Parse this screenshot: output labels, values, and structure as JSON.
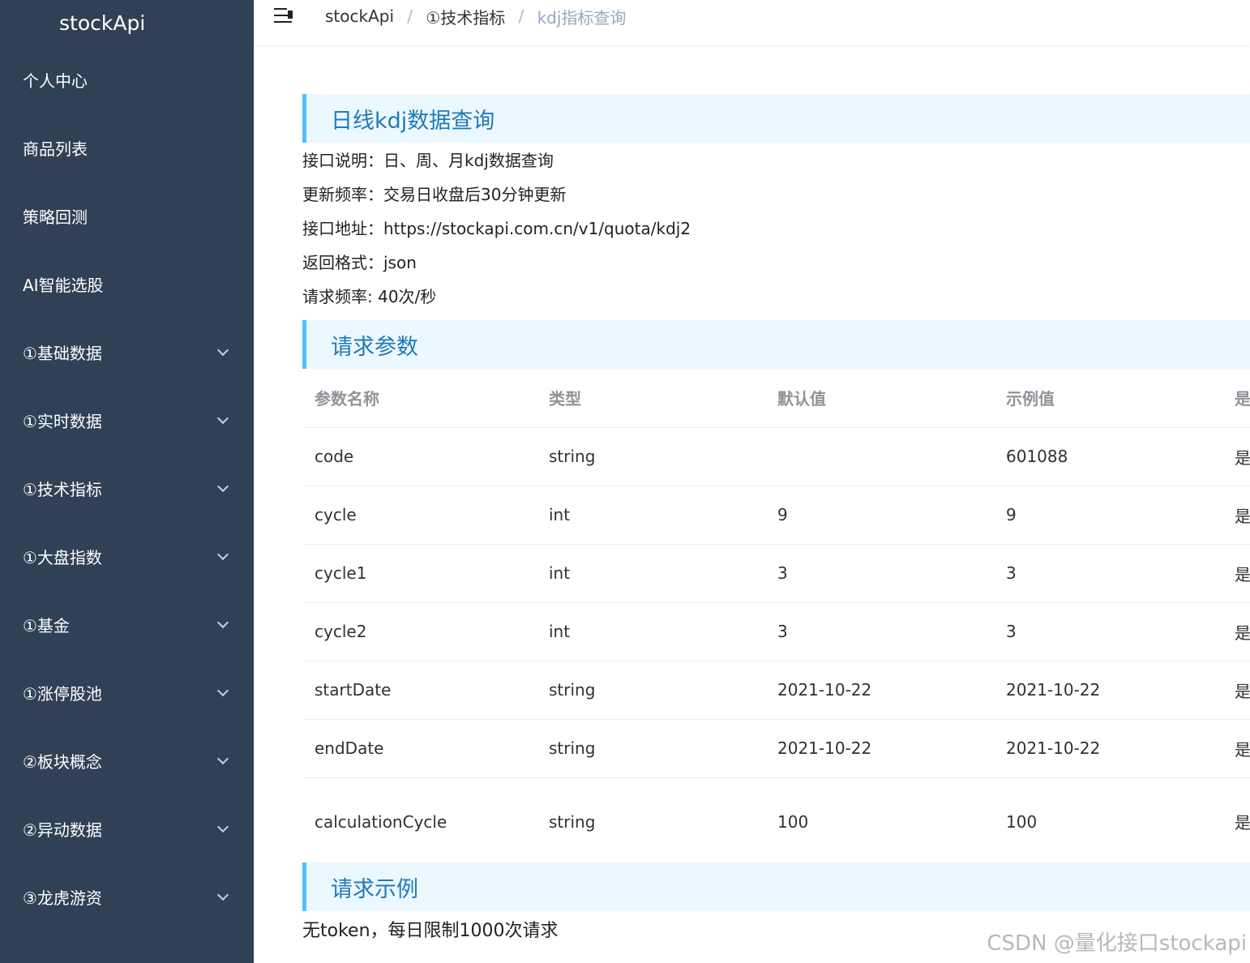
{
  "sidebar": {
    "logo": "stockApi",
    "items": [
      {
        "label": "个人中心",
        "expandable": false
      },
      {
        "label": "商品列表",
        "expandable": false
      },
      {
        "label": "策略回测",
        "expandable": false
      },
      {
        "label": "AI智能选股",
        "expandable": false
      },
      {
        "label": "①基础数据",
        "expandable": true
      },
      {
        "label": "①实时数据",
        "expandable": true
      },
      {
        "label": "①技术指标",
        "expandable": true
      },
      {
        "label": "①大盘指数",
        "expandable": true
      },
      {
        "label": "①基金",
        "expandable": true
      },
      {
        "label": "①涨停股池",
        "expandable": true
      },
      {
        "label": "②板块概念",
        "expandable": true
      },
      {
        "label": "②异动数据",
        "expandable": true
      },
      {
        "label": "③龙虎游资",
        "expandable": true
      }
    ]
  },
  "header": {
    "breadcrumb": [
      "stockApi",
      "①技术指标",
      "kdj指标查询"
    ]
  },
  "main": {
    "title": "日线kdj数据查询",
    "info": [
      "接口说明：日、周、月kdj数据查询",
      "更新频率：交易日收盘后30分钟更新",
      "接口地址：https://stockapi.com.cn/v1/quota/kdj2",
      "返回格式：json",
      "请求频率: 40次/秒"
    ],
    "params_title": "请求参数",
    "table": {
      "headers": [
        "参数名称",
        "类型",
        "默认值",
        "示例值",
        "是"
      ],
      "rows": [
        [
          "code",
          "string",
          "",
          "601088",
          "是"
        ],
        [
          "cycle",
          "int",
          "9",
          "9",
          "是"
        ],
        [
          "cycle1",
          "int",
          "3",
          "3",
          "是"
        ],
        [
          "cycle2",
          "int",
          "3",
          "3",
          "是"
        ],
        [
          "startDate",
          "string",
          "2021-10-22",
          "2021-10-22",
          "是"
        ],
        [
          "endDate",
          "string",
          "2021-10-22",
          "2021-10-22",
          "是"
        ],
        [
          "calculationCycle",
          "string",
          "100",
          "100",
          "是"
        ]
      ]
    },
    "example_title": "请求示例",
    "example_note": "无token，每日限制1000次请求"
  },
  "watermark": "CSDN @量化接口stockapi",
  "colors": {
    "sidebar_bg": "#304156",
    "section_bg": "#ecf8ff",
    "section_border": "#50bfff",
    "section_text": "#1f7ab8",
    "breadcrumb_current": "#97a8be"
  }
}
